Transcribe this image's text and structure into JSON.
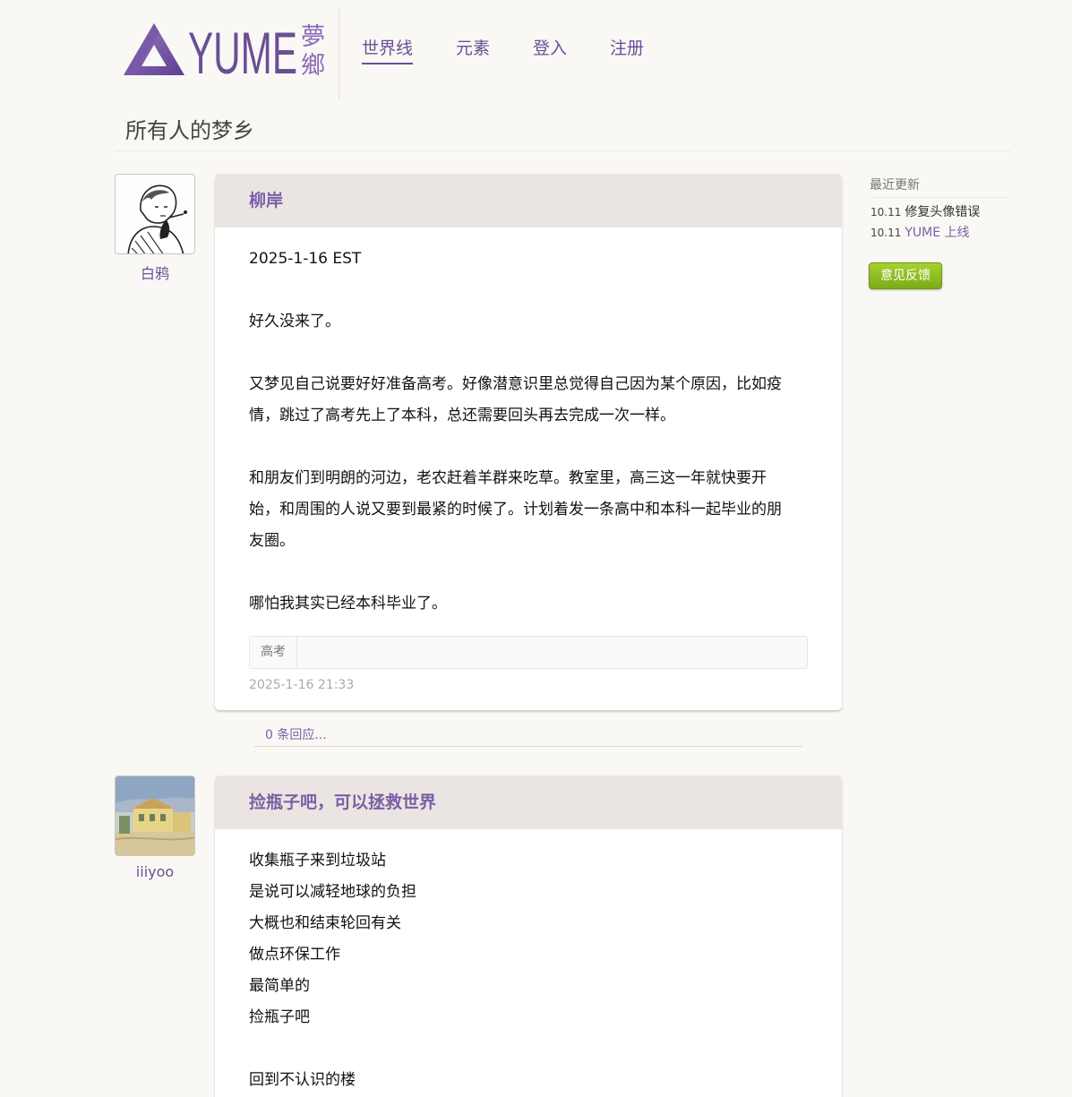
{
  "header": {
    "logo_text": "YUME",
    "logo_sub_1": "夢",
    "logo_sub_2": "鄉",
    "nav": [
      {
        "label": "世界线",
        "active": true
      },
      {
        "label": "元素",
        "active": false
      },
      {
        "label": "登入",
        "active": false
      },
      {
        "label": "注册",
        "active": false
      }
    ]
  },
  "page": {
    "title": "所有人的梦乡"
  },
  "posts": [
    {
      "author": "白鸦",
      "title": "柳岸",
      "body": [
        "2025-1-16 EST",
        "",
        "好久没来了。",
        "",
        "又梦见自己说要好好准备高考。好像潜意识里总觉得自己因为某个原因，比如疫",
        "情，跳过了高考先上了本科，总还需要回头再去完成一次一样。",
        "",
        "和朋友们到明朗的河边，老农赶着羊群来吃草。教室里，高三这一年就快要开",
        "始，和周围的人说又要到最紧的时候了。计划着发一条高中和本科一起毕业的朋",
        "友圈。",
        "",
        "哪怕我其实已经本科毕业了。"
      ],
      "tags": [
        "高考"
      ],
      "time": "2025-1-16 21:33",
      "replies": "0 条回应..."
    },
    {
      "author": "iiiyoo",
      "title": "捡瓶子吧，可以拯救世界",
      "body": [
        "收集瓶子来到垃圾站",
        "是说可以减轻地球的负担",
        "大概也和结束轮回有关",
        "做点环保工作",
        "最简单的",
        "捡瓶子吧",
        "",
        "回到不认识的楼"
      ]
    }
  ],
  "sidebar": {
    "title": "最近更新",
    "updates": [
      {
        "date": "10.11",
        "text": "修复头像错误",
        "link": false
      },
      {
        "date": "10.11",
        "text": "YUME 上线",
        "link": true
      }
    ],
    "feedback_label": "意见反馈"
  },
  "colors": {
    "accent": "#6a4f96",
    "card_header": "#eae5e2",
    "background": "#faf8f5",
    "feedback": "#8dbd1f"
  }
}
